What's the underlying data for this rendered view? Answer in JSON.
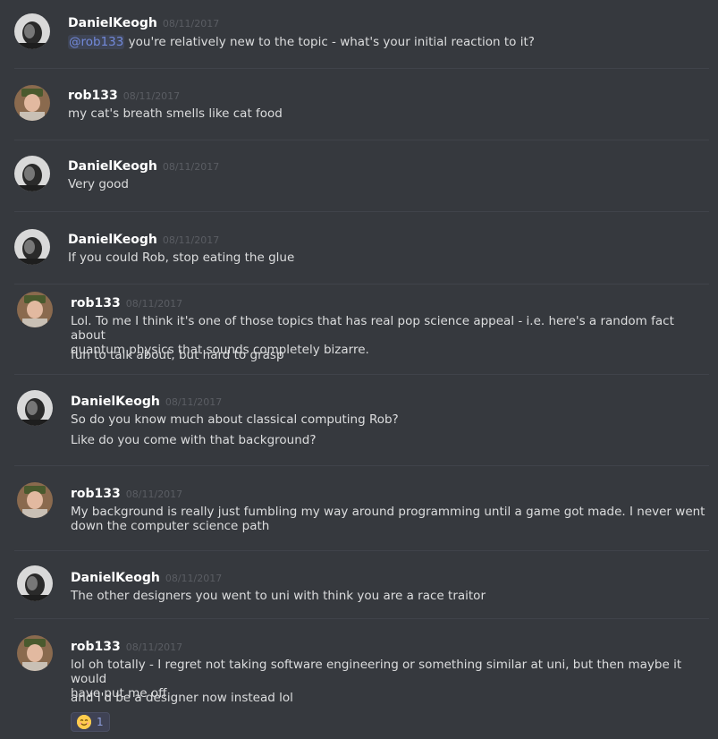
{
  "messages": [
    {
      "author": "DanielKeogh",
      "timestamp": "08/11/2017",
      "mention": "@rob133",
      "lines": [
        " you're relatively new to the topic - what's your initial reaction to it?"
      ]
    },
    {
      "author": "rob133",
      "timestamp": "08/11/2017",
      "lines": [
        "my cat's breath smells like cat food"
      ]
    },
    {
      "author": "DanielKeogh",
      "timestamp": "08/11/2017",
      "lines": [
        "Very good"
      ]
    },
    {
      "author": "DanielKeogh",
      "timestamp": "08/11/2017",
      "lines": [
        "If you could Rob, stop eating the glue"
      ]
    },
    {
      "author": "rob133",
      "timestamp": "08/11/2017",
      "lines": [
        "Lol. To me I think it's one of those topics that has real pop science appeal - i.e. here's a random fact about\nquantum physics that sounds completely bizarre.",
        "fun to talk about, but hard to grasp"
      ]
    },
    {
      "author": "DanielKeogh",
      "timestamp": "08/11/2017",
      "lines": [
        "So do you know much about classical computing Rob?",
        "Like do you come with that background?"
      ]
    },
    {
      "author": "rob133",
      "timestamp": "08/11/2017",
      "lines": [
        "My background is really just fumbling my way around programming until a game got made. I never went\ndown the computer science path"
      ]
    },
    {
      "author": "DanielKeogh",
      "timestamp": "08/11/2017",
      "lines": [
        "The other designers you went to uni with think you are a race traitor"
      ]
    },
    {
      "author": "rob133",
      "timestamp": "08/11/2017",
      "lines": [
        "lol oh totally - I regret not taking software engineering or something similar at uni, but then maybe it would\nhave put me off",
        "and I'd be a designer now instead lol"
      ],
      "reaction": {
        "emoji": "smiling-face-emoji",
        "count": "1"
      }
    }
  ],
  "colors": {
    "background": "#36393e",
    "author": "#ffffff",
    "timestamp": "#5a5d63",
    "text": "#dcddde",
    "mention": "#7289da"
  }
}
